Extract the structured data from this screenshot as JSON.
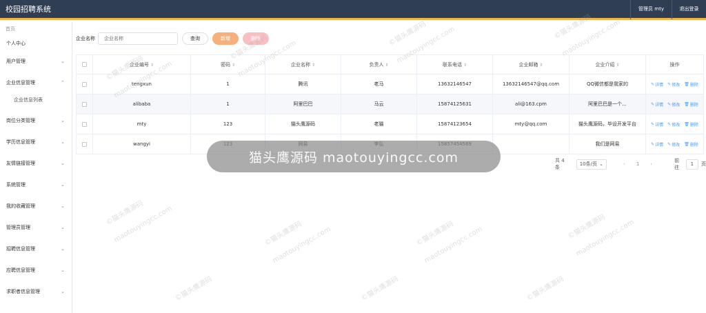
{
  "header": {
    "title": "校园招聘系统",
    "user": "管理员 mty",
    "logout": "退出登录"
  },
  "sidebar": {
    "breadcrumb": "首页",
    "items": [
      {
        "label": "个人中心",
        "expandable": false
      },
      {
        "label": "用户管理",
        "expandable": true
      },
      {
        "label": "企业信息管理",
        "expandable": true,
        "expanded": true
      },
      {
        "label": "岗位分类管理",
        "expandable": true
      },
      {
        "label": "学历信息管理",
        "expandable": true
      },
      {
        "label": "友情链接管理",
        "expandable": true
      },
      {
        "label": "系统管理",
        "expandable": true
      },
      {
        "label": "我的收藏管理",
        "expandable": true
      },
      {
        "label": "管理员管理",
        "expandable": true
      },
      {
        "label": "招聘信息管理",
        "expandable": true
      },
      {
        "label": "应聘信息管理",
        "expandable": true
      },
      {
        "label": "求职者信息管理",
        "expandable": true
      }
    ],
    "sub_item": "企业信息列表"
  },
  "search": {
    "label": "企业名称",
    "placeholder": "企业名称",
    "query_button": "查询",
    "add_button": "新增",
    "delete_button": "删除"
  },
  "table": {
    "columns": [
      "企业编号",
      "密码",
      "企业名称",
      "负责人",
      "联系电话",
      "企业邮箱",
      "企业介绍",
      "操作"
    ],
    "rows": [
      [
        "tengxun",
        "1",
        "腾讯",
        "老马",
        "13632146547",
        "13632146547@qq.com",
        "QQ微信都是我家的"
      ],
      [
        "alibaba",
        "1",
        "阿里巴巴",
        "马云",
        "15874125631",
        "ali@163.cpm",
        "阿里巴巴是一个..."
      ],
      [
        "mty",
        "123",
        "猫头鹰源码",
        "老猫",
        "15874123654",
        "mty@qq.com",
        "猫头鹰源码，毕设开发平台"
      ],
      [
        "wangyi",
        "123",
        "网易",
        "李弘",
        "15857454569",
        "",
        "我们是网易"
      ]
    ],
    "actions": {
      "detail": "详情",
      "edit": "修改",
      "delete": "删除"
    }
  },
  "pager": {
    "total": "共 4 条",
    "page_size": "10条/页",
    "current_page": "1",
    "goto_label": "前往",
    "goto_value": "1",
    "page_suffix": "页"
  },
  "watermark": {
    "banner": "猫头鹰源码 maotouyingcc.com",
    "tile_a": "©猫头鹰源码",
    "tile_b": "maotouyingcc.com"
  }
}
